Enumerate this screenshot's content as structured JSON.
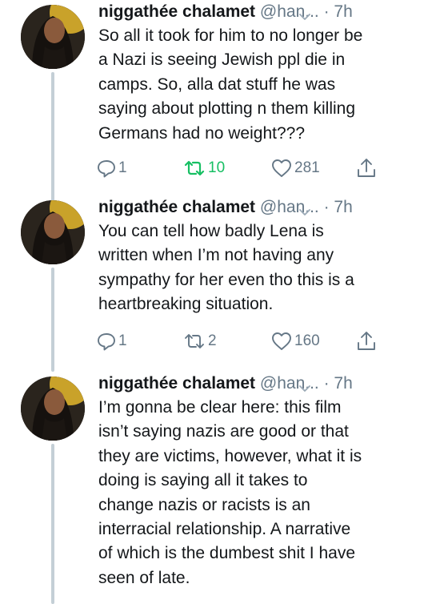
{
  "tweets": [
    {
      "display_name": "niggathée chalamet",
      "handle": "@han...",
      "time": "· 7h",
      "text": "So all it took for him to no longer be\na Nazi is seeing Jewish ppl die in\ncamps. So, alla dat stuff he was\nsaying about plotting n them killing\nGermans had no weight???",
      "replies": "1",
      "retweets": "10",
      "likes": "281",
      "retweeted": true
    },
    {
      "display_name": "niggathée chalamet",
      "handle": "@han...",
      "time": "· 7h",
      "text": "You can tell how badly Lena is\nwritten when I’m not having any\nsympathy for her even tho this is a\nheartbreaking situation.",
      "replies": "1",
      "retweets": "2",
      "likes": "160",
      "retweeted": false
    },
    {
      "display_name": "niggathée chalamet",
      "handle": "@han...",
      "time": "· 7h",
      "text": "I’m gonna be clear here: this film\nisn’t saying nazis are good or that\nthey are victims, however, what it is\ndoing is saying all it takes to\nchange nazis or racists is an\ninterracial relationship. A narrative\nof which is the dumbest shit I have\nseen of late.",
      "retweeted": false
    }
  ],
  "colors": {
    "text": "#14171a",
    "muted": "#657786",
    "retweet_active": "#17bf63",
    "thread_line": "#c4cfd6",
    "avatar_bg_yellow": "#c9a22a"
  },
  "icons": {
    "reply": "reply-icon",
    "retweet": "retweet-icon",
    "like": "heart-icon",
    "share": "share-icon",
    "menu": "chevron-down-icon"
  }
}
